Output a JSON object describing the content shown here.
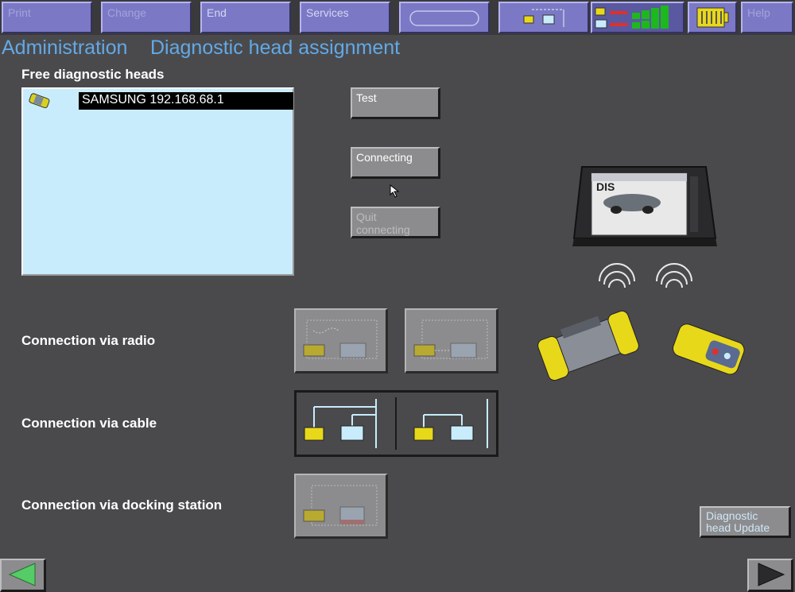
{
  "toolbar": {
    "print": "Print",
    "change": "Change",
    "end": "End",
    "services": "Services",
    "help": "Help"
  },
  "header": {
    "section": "Administration",
    "page": "Diagnostic head assignment"
  },
  "free_heads": {
    "label": "Free diagnostic heads",
    "items": [
      {
        "name": "SAMSUNG 192.168.68.1",
        "selected": true
      }
    ]
  },
  "actions": {
    "test": "Test",
    "connecting": "Connecting",
    "quit_line1": "Quit",
    "quit_line2": "connecting"
  },
  "connections": {
    "radio": "Connection via radio",
    "cable": "Connection via cable",
    "docking": "Connection via docking station"
  },
  "illustration": {
    "screen_brand": "DIS"
  },
  "update": {
    "line1": "Diagnostic",
    "line2": "head Update"
  },
  "colors": {
    "toolbar_button": "#7b79c6",
    "title": "#63a9e6",
    "list_background": "#c8ecfc",
    "device_yellow": "#e8d81a",
    "status_green": "#1db81d",
    "status_red": "#e0302a",
    "nav_arrow": "#55cc66"
  }
}
